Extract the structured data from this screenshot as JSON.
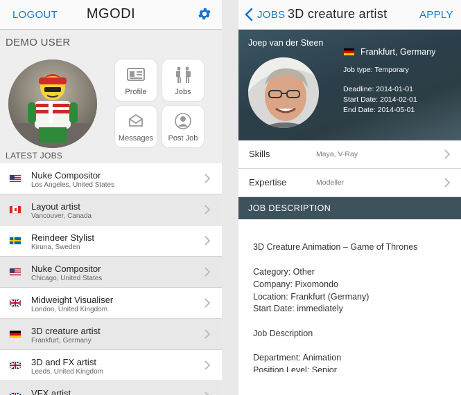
{
  "left": {
    "nav": {
      "logout": "LOGOUT",
      "title": "MGODI",
      "settings_icon": "gear-icon"
    },
    "user_name": "DEMO USER",
    "tiles": [
      {
        "label": "Profile",
        "icon": "profile-card-icon"
      },
      {
        "label": "Jobs",
        "icon": "people-icon"
      },
      {
        "label": "Messages",
        "icon": "envelope-icon"
      },
      {
        "label": "Post Job",
        "icon": "person-add-icon"
      }
    ],
    "latest_jobs_heading": "LATEST JOBS",
    "jobs": [
      {
        "title": "Nuke Compositor",
        "location": "Los Angeles, United States",
        "flag": "us"
      },
      {
        "title": "Layout artist",
        "location": "Vancouver, Canada",
        "flag": "ca"
      },
      {
        "title": "Reindeer Stylist",
        "location": "Kiruna, Sweden",
        "flag": "se"
      },
      {
        "title": "Nuke  Compositor",
        "location": "Chicago, United States",
        "flag": "us"
      },
      {
        "title": "Midweight Visualiser",
        "location": "London, United Kingdom",
        "flag": "gb"
      },
      {
        "title": "3D creature artist",
        "location": "Frankfurt, Germany",
        "flag": "de"
      },
      {
        "title": "3D and FX artist",
        "location": "Leeds, United Kingdom",
        "flag": "gb"
      },
      {
        "title": "VFX artist",
        "location": "",
        "flag": "gb"
      }
    ]
  },
  "right": {
    "nav": {
      "back": "JOBS",
      "title": "3D creature artist",
      "apply": "APPLY"
    },
    "header": {
      "person": "Joep van der Steen",
      "location": "Frankfurt, Germany",
      "job_type": "Job type: Temporary",
      "deadline": "Deadline: 2014-01-01",
      "start_date": "Start Date: 2014-02-01",
      "end_date": "End Date: 2014-05-01"
    },
    "skills": {
      "label": "Skills",
      "value": "Maya, V-Ray"
    },
    "expertise": {
      "label": "Expertise",
      "value": "Modeller"
    },
    "section_title": "JOB DESCRIPTION",
    "description": {
      "title": "3D Creature Animation – Game of Thrones",
      "category": "Category: Other",
      "company": "Company: Pixomondo",
      "location": "Location: Frankfurt (Germany)",
      "start": "Start Date: immediately",
      "job_desc": "Job Description",
      "department": "Department: Animation",
      "position": "Position Level: Senior"
    }
  },
  "colors": {
    "accent": "#1a73c9",
    "header_dark": "#2d3f48",
    "section": "#3d525d"
  }
}
